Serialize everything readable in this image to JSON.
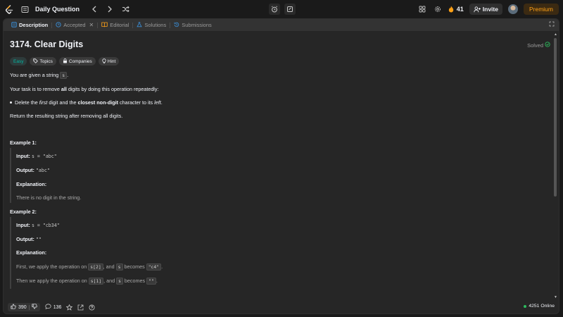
{
  "topbar": {
    "daily_question_label": "Daily Question",
    "streak_count": "41",
    "invite_label": "Invite",
    "premium_label": "Premium"
  },
  "tabs": [
    {
      "label": "Description",
      "icon": "description-icon",
      "active": true
    },
    {
      "label": "Accepted",
      "icon": "clock-icon",
      "active": false,
      "closable": true
    },
    {
      "label": "Editorial",
      "icon": "book-icon",
      "active": false
    },
    {
      "label": "Solutions",
      "icon": "flask-icon",
      "active": false
    },
    {
      "label": "Submissions",
      "icon": "history-icon",
      "active": false
    }
  ],
  "problem": {
    "title": "3174. Clear Digits",
    "status": "Solved",
    "difficulty": "Easy",
    "chips": [
      "Topics",
      "Companies",
      "Hint"
    ],
    "intro_a": "You are given a string ",
    "intro_code": "s",
    "intro_b": ".",
    "task_a": "Your task is to remove ",
    "task_bold": "all",
    "task_b": " digits by doing this operation repeatedly:",
    "bullet_a": "Delete the ",
    "bullet_first": "first",
    "bullet_b": " digit and the ",
    "bullet_bold": "closest non-digit",
    "bullet_c": " character to its ",
    "bullet_left": "left",
    "bullet_d": ".",
    "return_text": "Return the resulting string after removing all digits."
  },
  "examples": [
    {
      "heading": "Example 1:",
      "input_label": "Input:",
      "input_value": "s = \"abc\"",
      "output_label": "Output:",
      "output_value": "\"abc\"",
      "explanation_label": "Explanation:",
      "explanation": "There is no digit in the string."
    },
    {
      "heading": "Example 2:",
      "input_label": "Input:",
      "input_value": "s = \"cb34\"",
      "output_label": "Output:",
      "output_value": "\"\"",
      "explanation_label": "Explanation:",
      "line1_a": "First, we apply the operation on ",
      "line1_code1": "s[2]",
      "line1_b": ", and ",
      "line1_code2": "s",
      "line1_c": " becomes ",
      "line1_code3": "\"c4\"",
      "line1_d": ".",
      "line2_a": "Then we apply the operation on ",
      "line2_code1": "s[1]",
      "line2_b": ", and ",
      "line2_code2": "s",
      "line2_c": " becomes ",
      "line2_code3": "\"\"",
      "line2_d": "."
    }
  ],
  "bottombar": {
    "likes": "390",
    "comments": "136",
    "online": "4251 Online"
  },
  "colors": {
    "accent_orange": "#ffa116",
    "easy_teal": "#00b8a3",
    "solved_green": "#2cbb5d",
    "tab_active_blue": "#3a8fd9"
  }
}
